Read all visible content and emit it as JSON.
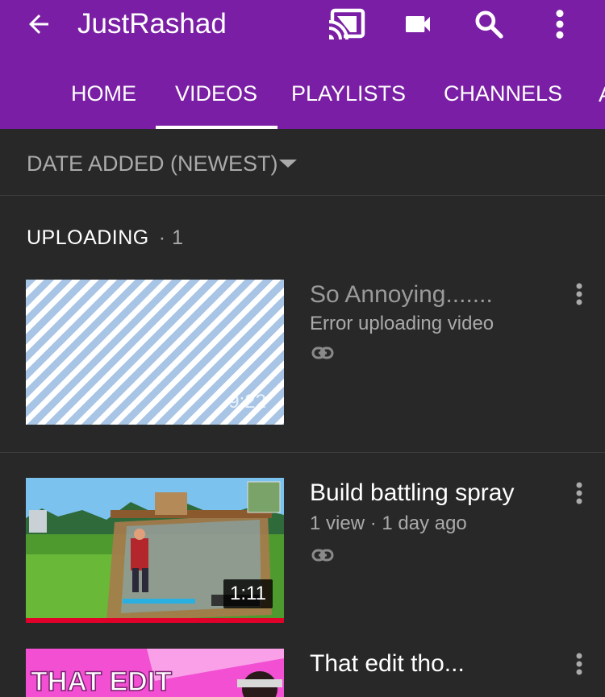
{
  "appbar": {
    "back_icon": "arrow-left-icon",
    "title": "JustRashad",
    "icons": [
      "cast-icon",
      "video-camera-icon",
      "search-icon",
      "more-vertical-icon"
    ],
    "color": "#7a1fa5"
  },
  "tabs": [
    {
      "label": "HOME",
      "active": false
    },
    {
      "label": "VIDEOS",
      "active": true
    },
    {
      "label": "PLAYLISTS",
      "active": false
    },
    {
      "label": "CHANNELS",
      "active": false
    },
    {
      "label": "A",
      "active": false
    }
  ],
  "sort": {
    "label": "DATE ADDED (NEWEST)",
    "icon": "caret-down-icon"
  },
  "uploading": {
    "title": "UPLOADING",
    "separator": "·",
    "count": "1"
  },
  "videos": [
    {
      "title": "So Annoying.......",
      "subtitle": "Error uploading video",
      "duration": "9:22",
      "visibility_icon": "link-icon",
      "menu_icon": "more-vertical-icon"
    },
    {
      "title": "Build battling spray",
      "subtitle": "1 view · 1 day ago",
      "duration": "1:11",
      "watched_progress": 1.0,
      "visibility_icon": "link-icon",
      "menu_icon": "more-vertical-icon"
    },
    {
      "title": "That edit tho...",
      "thumbnail_text": "THAT EDIT",
      "menu_icon": "more-vertical-icon"
    }
  ],
  "colors": {
    "background": "#282828",
    "text_secondary": "#aaaaaa",
    "progress": "#e1002a"
  }
}
